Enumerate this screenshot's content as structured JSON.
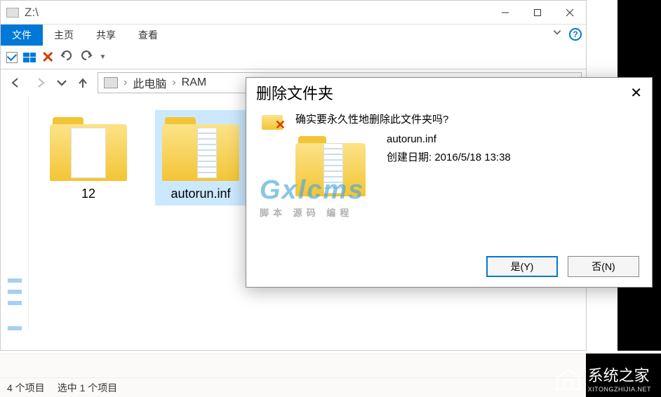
{
  "window": {
    "title": "Z:\\",
    "tabs": {
      "file": "文件",
      "home": "主页",
      "share": "共享",
      "view": "查看"
    },
    "breadcrumb": {
      "pc": "此电脑",
      "drive": "RAM"
    }
  },
  "folders": [
    {
      "name": "12"
    },
    {
      "name": "autorun.inf"
    }
  ],
  "status": {
    "count": "4 个项目",
    "selected": "选中 1 个项目"
  },
  "dialog": {
    "title": "删除文件夹",
    "confirm": "确实要永久性地删除此文件夹吗?",
    "filename": "autorun.inf",
    "created_label": "创建日期:",
    "created_value": "2016/5/18 13:38",
    "yes": "是(Y)",
    "no": "否(N)"
  },
  "watermark": {
    "brand": "Gxlcms",
    "sub": "脚本 源码 编程",
    "footer_name": "系统之家",
    "footer_url": "XITONGZHIJIA.NET"
  }
}
